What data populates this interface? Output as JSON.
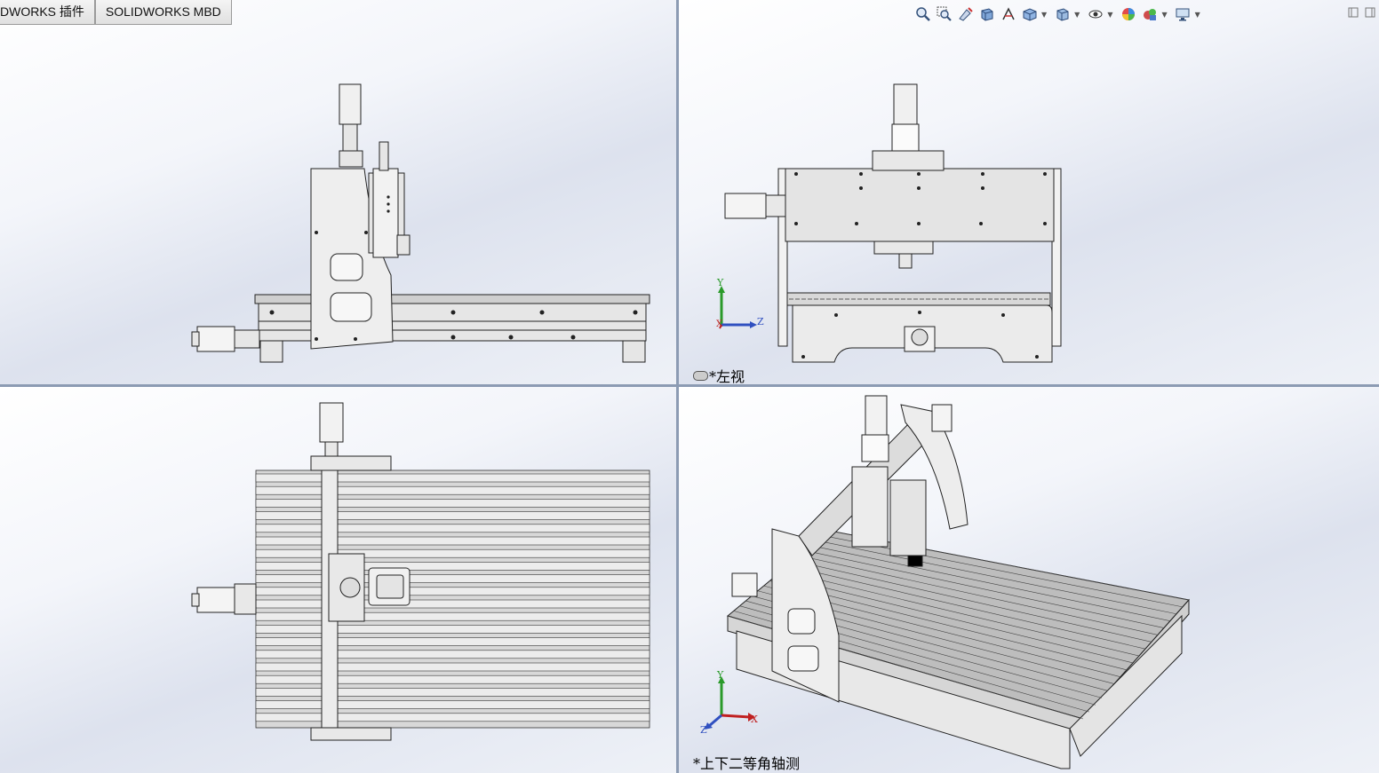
{
  "tabs": [
    {
      "label": "DWORKS 插件"
    },
    {
      "label": "SOLIDWORKS MBD"
    }
  ],
  "view_labels": {
    "right_view": "*左视",
    "isometric_view": "*上下二等角轴测"
  },
  "triad": {
    "x": "X",
    "y": "Y",
    "z": "Z"
  },
  "toolbar_icons": [
    "zoom-to-fit-icon",
    "zoom-area-icon",
    "previous-view-icon",
    "section-view-icon",
    "dynamic-annotation-icon",
    "view-orientation-icon",
    "display-style-icon",
    "hide-show-items-icon",
    "edit-appearance-icon",
    "apply-scene-icon",
    "view-settings-icon"
  ],
  "window_controls": [
    "restore-icon",
    "close-icon"
  ]
}
